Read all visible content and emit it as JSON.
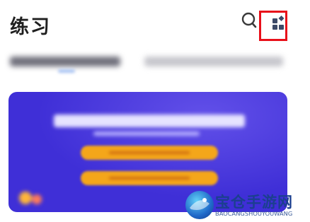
{
  "header": {
    "title": "练习",
    "search_icon": "search-icon",
    "apps_icon": "apps-grid-icon",
    "highlight_color": "#e8101a"
  },
  "tabs": {
    "active_indicator_color": "#a9c4f3"
  },
  "banner": {
    "background_color": "#3f2fd7",
    "button_color": "#f4a61a"
  },
  "watermark": {
    "title": "宝仓手游网",
    "subtitle": "BAOCANGSHOUYOUWANG"
  }
}
